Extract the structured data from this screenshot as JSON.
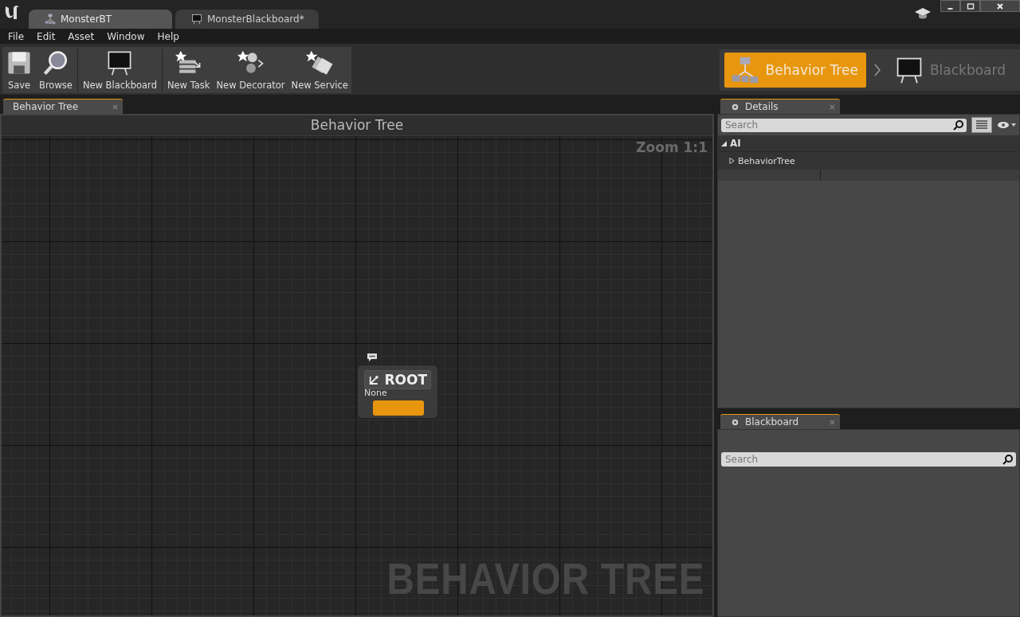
{
  "doc_tabs": [
    {
      "label": "MonsterBT",
      "selected": true
    },
    {
      "label": "MonsterBlackboard*",
      "selected": false
    }
  ],
  "menu": [
    "File",
    "Edit",
    "Asset",
    "Window",
    "Help"
  ],
  "toolbar": [
    {
      "label": "Save"
    },
    {
      "label": "Browse"
    },
    {
      "label": "New Blackboard"
    },
    {
      "label": "New Task"
    },
    {
      "label": "New Decorator"
    },
    {
      "label": "New Service"
    }
  ],
  "modes": [
    {
      "label": "Behavior Tree",
      "selected": true
    },
    {
      "label": "Blackboard",
      "selected": false
    }
  ],
  "graph": {
    "tab": "Behavior Tree",
    "title": "Behavior Tree",
    "zoom": "Zoom 1:1",
    "watermark": "BEHAVIOR TREE",
    "node": {
      "title": "ROOT",
      "subtitle": "None"
    }
  },
  "details": {
    "tab": "Details",
    "search": {
      "placeholder": "Search"
    },
    "category": {
      "label": "AI",
      "expanded": true,
      "children": [
        {
          "label": "BehaviorTree",
          "expanded": false
        }
      ]
    }
  },
  "blackboard": {
    "tab": "Blackboard",
    "search": {
      "placeholder": "Search"
    }
  }
}
